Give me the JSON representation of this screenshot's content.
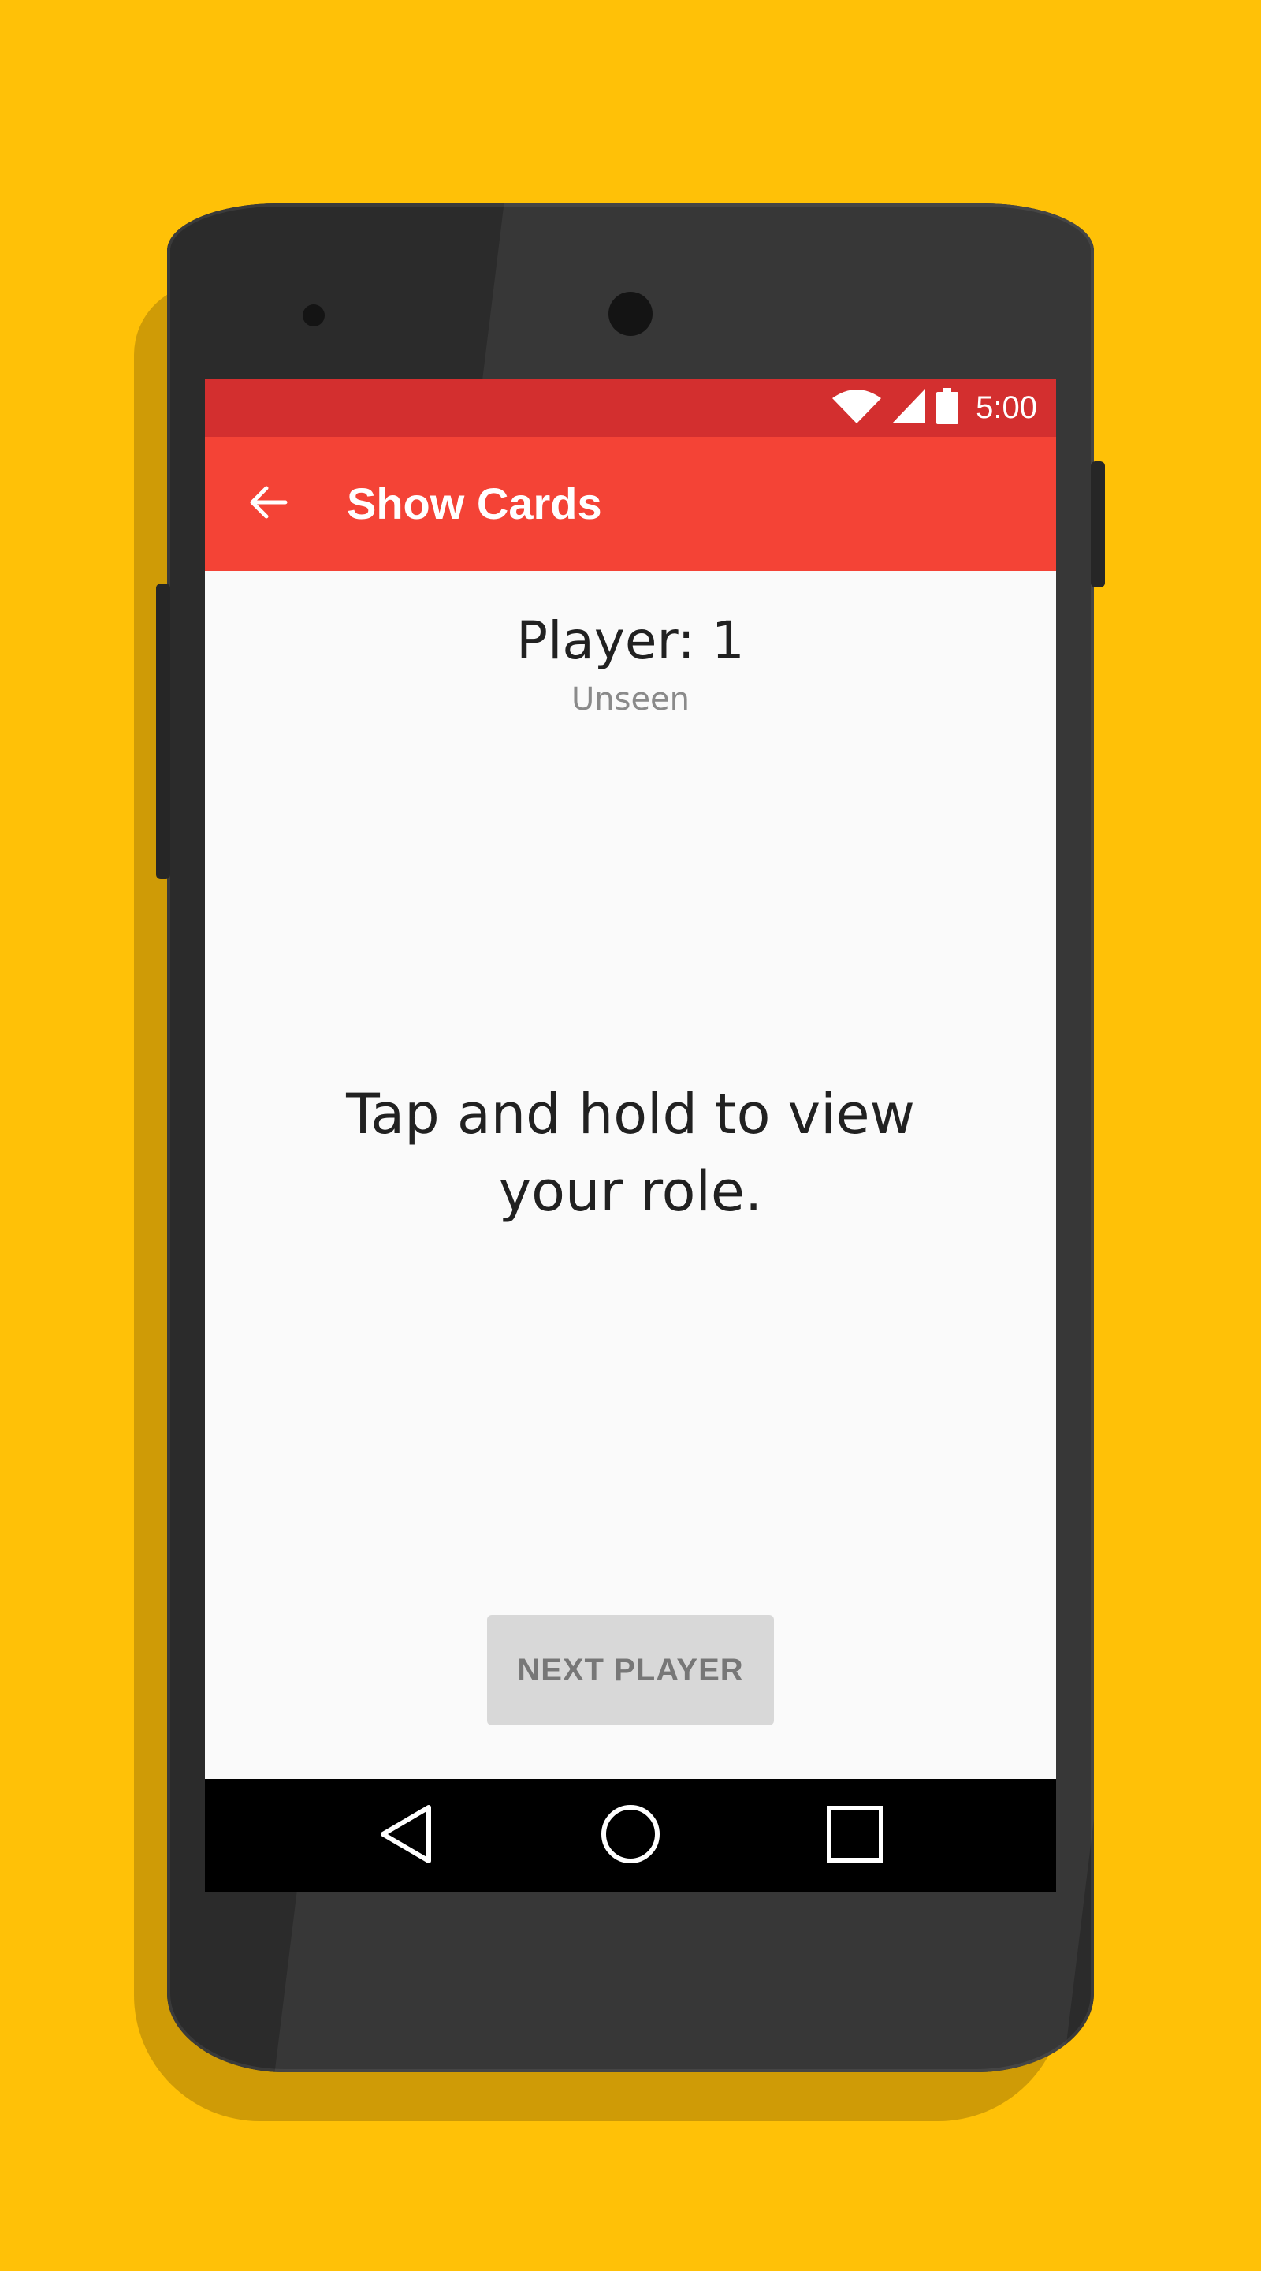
{
  "status_bar": {
    "time": "5:00",
    "icons": [
      "wifi-icon",
      "signal-icon",
      "battery-icon"
    ]
  },
  "app_bar": {
    "back_icon": "arrow-back-icon",
    "title": "Show Cards"
  },
  "content": {
    "player_label": "Player: 1",
    "player_status": "Unseen",
    "instruction": "Tap and hold to view your role.",
    "next_button_label": "NEXT PLAYER"
  },
  "nav_bar": {
    "icons": [
      "back-triangle-icon",
      "home-circle-icon",
      "recents-square-icon"
    ]
  },
  "colors": {
    "background": "#FFC107",
    "status_bar": "#D32F2F",
    "app_bar": "#F44336",
    "screen": "#FAFAFA",
    "button_disabled": "#D8D8D8"
  }
}
